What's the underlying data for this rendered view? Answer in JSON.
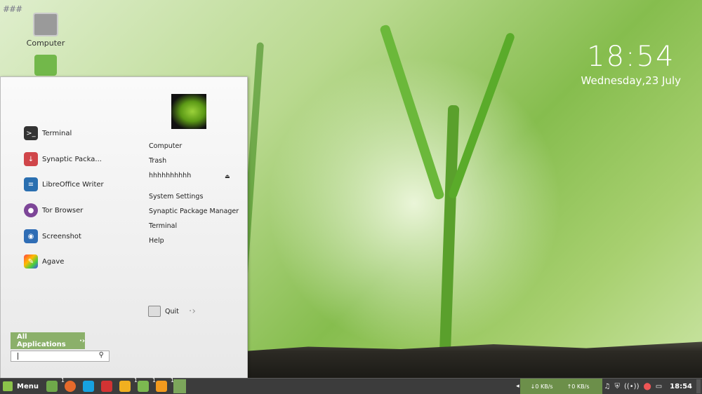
{
  "desktop": {
    "icons": [
      {
        "label": "Computer",
        "icon": "computer-icon"
      },
      {
        "label": "",
        "icon": "home-folder-icon"
      }
    ]
  },
  "clock": {
    "time": "18:54",
    "date": "Wednesday,23 July"
  },
  "menu": {
    "favorites": [
      {
        "label": "Terminal",
        "icon": "terminal-icon",
        "color": "#333333"
      },
      {
        "label": "Synaptic Packa...",
        "icon": "package-icon",
        "color": "#d0464a"
      },
      {
        "label": "LibreOffice Writer",
        "icon": "writer-icon",
        "color": "#2a6fb0"
      },
      {
        "label": "Tor Browser",
        "icon": "onion-icon",
        "color": "#7d4698"
      },
      {
        "label": "Screenshot",
        "icon": "camera-icon",
        "color": "#2f6db5"
      },
      {
        "label": "Agave",
        "icon": "color-picker-icon",
        "color": "#e0523a"
      }
    ],
    "places": [
      "Computer",
      "Trash",
      "hhhhhhhhhh"
    ],
    "system": [
      "System Settings",
      "Synaptic Package Manager",
      "Terminal",
      "Help"
    ],
    "quit_label": "Quit",
    "all_apps_label": "All Applications",
    "search_value": ""
  },
  "panel": {
    "menu_label": "Menu",
    "launchers": [
      {
        "icon": "folder-icon",
        "color": "#6fa84a",
        "badge": "1"
      },
      {
        "icon": "firefox-icon",
        "color": "#e66a2b",
        "badge": ""
      },
      {
        "icon": "skype-icon",
        "color": "#17a2e0",
        "badge": ""
      },
      {
        "icon": "close-app-icon",
        "color": "#d33333",
        "badge": ""
      },
      {
        "icon": "windows-app-icon",
        "color": "#f0b020",
        "badge": "1"
      },
      {
        "icon": "files-icon",
        "color": "#7cb950",
        "badge": "1"
      },
      {
        "icon": "vlc-icon",
        "color": "#f39a1e",
        "badge": "1"
      }
    ],
    "download_rate": "↓0 KB/s",
    "upload_rate": "↑0 KB/s",
    "clock": "18:54"
  }
}
